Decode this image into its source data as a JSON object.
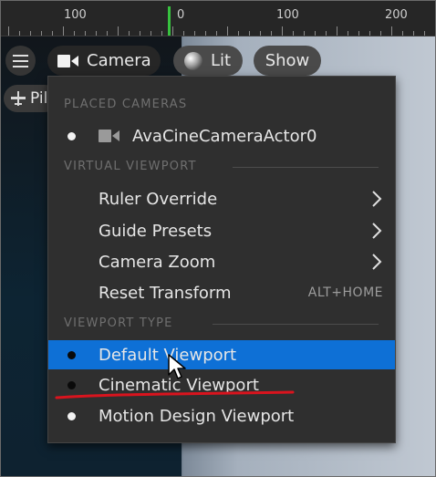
{
  "ruler": {
    "labels": [
      "100",
      "0",
      "100",
      "200"
    ]
  },
  "toolbar": {
    "camera_label": "Camera",
    "lit_label": "Lit",
    "show_label": "Show",
    "pilot_label": "Pil"
  },
  "menu": {
    "placed_cameras_header": "PLACED CAMERAS",
    "camera_actor": "AvaCineCameraActor0",
    "virtual_viewport_header": "VIRTUAL VIEWPORT",
    "ruler_override": "Ruler Override",
    "guide_presets": "Guide Presets",
    "camera_zoom": "Camera Zoom",
    "reset_transform": "Reset Transform",
    "reset_transform_shortcut": "ALT+HOME",
    "viewport_type_header": "VIEWPORT TYPE",
    "default_viewport": "Default Viewport",
    "cinematic_viewport": "Cinematic Viewport",
    "motion_design_viewport": "Motion Design Viewport"
  },
  "colors": {
    "highlight": "#0e70d6",
    "playhead": "#37c23f",
    "annotation_underline": "#d9141e"
  }
}
